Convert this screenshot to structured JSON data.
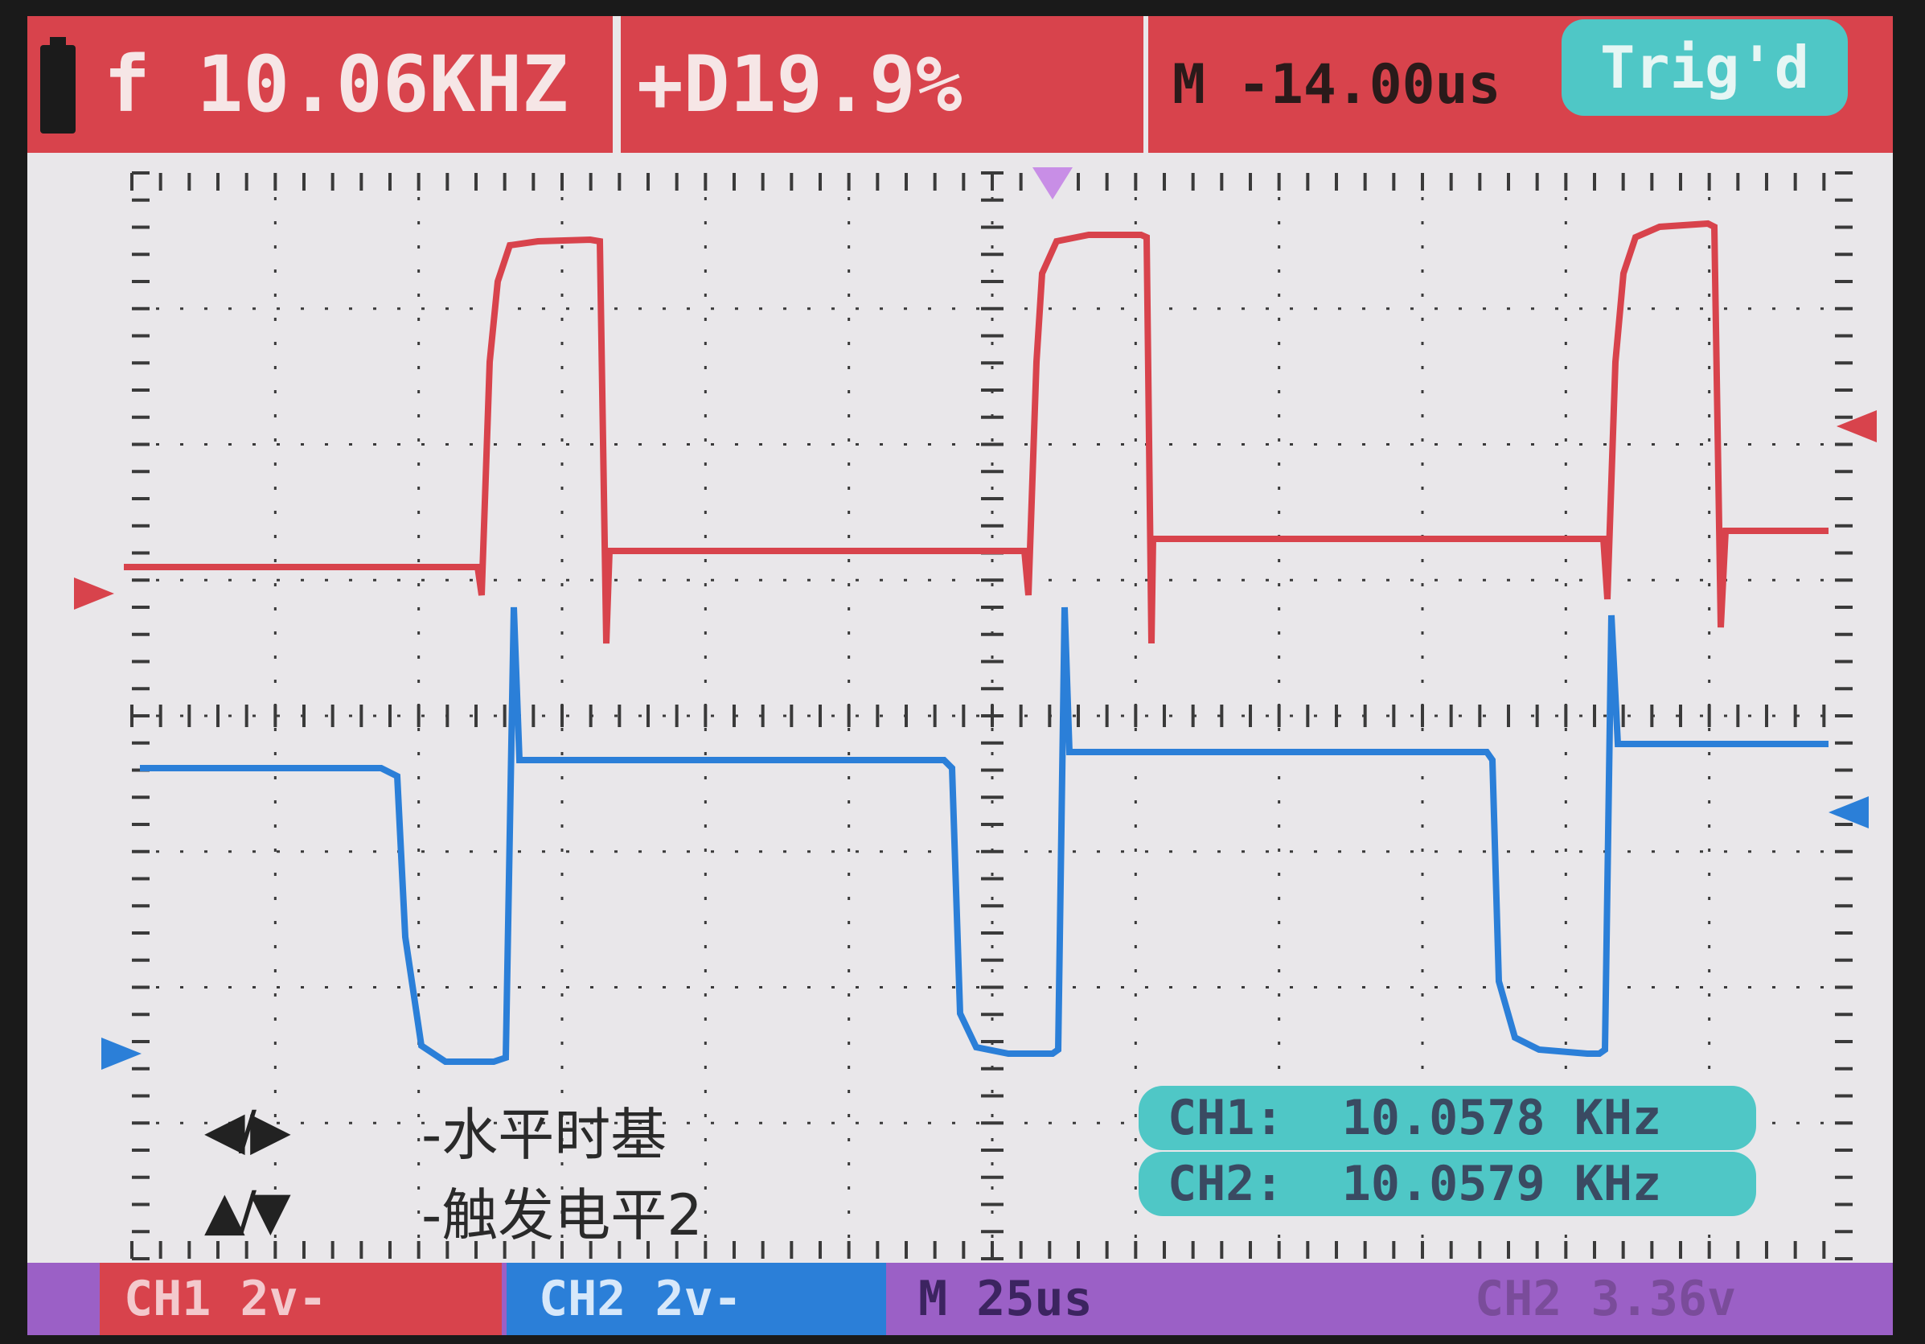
{
  "top_bar": {
    "frequency": "f 10.06KHZ",
    "duty": "+D19.9%",
    "time_label": "M",
    "time_offset": "-14.00us",
    "trigger_status": "Trig'd"
  },
  "help": {
    "line1_arrows": "◀/▶",
    "line1_text": "-水平时基",
    "line2_arrows": "▲/▼",
    "line2_text": "-触发电平2"
  },
  "measurements": {
    "ch1": "CH1:  10.0578 KHz",
    "ch2": "CH2:  10.0579 KHz"
  },
  "bottom_bar": {
    "ch1_scale": "CH1 2v-",
    "ch2_scale": "CH2  2v-",
    "timebase": "M 25us",
    "trigger_level": "CH2 3.36v"
  },
  "colors": {
    "ch1": "#d8434c",
    "ch2": "#2b7fd8",
    "accent_teal": "#4fc7c6",
    "bottom_bar": "#9b60c6",
    "background": "#e9e7ea"
  }
}
